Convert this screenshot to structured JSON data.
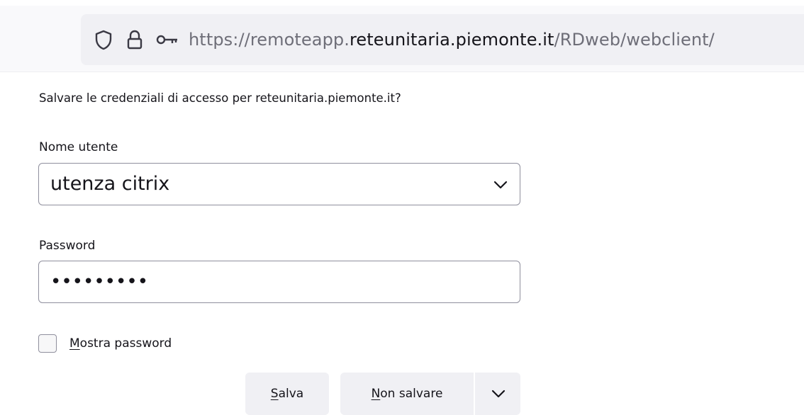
{
  "urlbar": {
    "icons": [
      "shield-icon",
      "lock-icon",
      "key-icon"
    ],
    "url_prefix": "https://remoteapp.",
    "url_domain": "reteunitaria.piemonte.it",
    "url_suffix": "/RDweb/webclient/"
  },
  "password_prompt": {
    "message": "Salvare le credenziali di accesso per reteunitaria.piemonte.it?",
    "username_label": "Nome utente",
    "username_value": "utenza citrix",
    "password_label": "Password",
    "password_masked": "•••••••••",
    "show_password": {
      "accesskey": "M",
      "rest": "ostra password",
      "checked": false
    },
    "buttons": {
      "save_accesskey": "S",
      "save_rest": "alva",
      "nosave_accesskey": "N",
      "nosave_rest": "on salvare",
      "menu_icon": "chevron-down-icon"
    }
  },
  "colors": {
    "toolbar_bg": "#f9f9fb",
    "urlbar_bg": "#f0f0f4",
    "button_bg": "#f0f0f4",
    "border": "#8f8f9d",
    "text": "#15141a",
    "url_muted": "#6e6e78"
  }
}
